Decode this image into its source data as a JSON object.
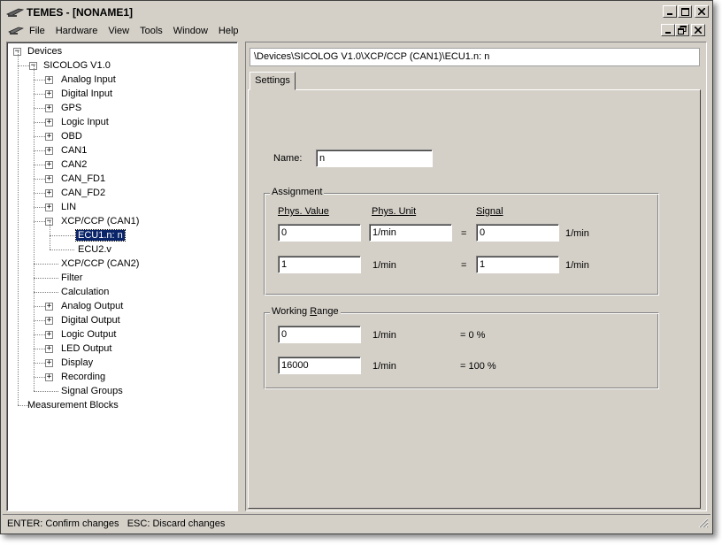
{
  "window": {
    "title": "TEMES - [NONAME1]"
  },
  "menu": {
    "items": [
      "File",
      "Hardware",
      "View",
      "Tools",
      "Window",
      "Help"
    ]
  },
  "tree": {
    "root": "Devices",
    "device": "SICOLOG V1.0",
    "items": [
      {
        "label": "Analog Input",
        "expandable": true
      },
      {
        "label": "Digital Input",
        "expandable": true
      },
      {
        "label": "GPS",
        "expandable": true
      },
      {
        "label": "Logic Input",
        "expandable": true
      },
      {
        "label": "OBD",
        "expandable": true
      },
      {
        "label": "CAN1",
        "expandable": true
      },
      {
        "label": "CAN2",
        "expandable": true
      },
      {
        "label": "CAN_FD1",
        "expandable": true
      },
      {
        "label": "CAN_FD2",
        "expandable": true
      },
      {
        "label": "LIN",
        "expandable": true
      },
      {
        "label": "XCP/CCP (CAN1)",
        "expandable": true,
        "expanded": true,
        "children": [
          {
            "label": "ECU1.n: n",
            "selected": true
          },
          {
            "label": "ECU2.v"
          }
        ]
      },
      {
        "label": "XCP/CCP (CAN2)",
        "expandable": false
      },
      {
        "label": "Filter",
        "expandable": false
      },
      {
        "label": "Calculation",
        "expandable": false
      },
      {
        "label": "Analog Output",
        "expandable": true
      },
      {
        "label": "Digital Output",
        "expandable": true
      },
      {
        "label": "Logic Output",
        "expandable": true
      },
      {
        "label": "LED Output",
        "expandable": true
      },
      {
        "label": "Display",
        "expandable": true
      },
      {
        "label": "Recording",
        "expandable": true
      },
      {
        "label": "Signal Groups",
        "expandable": false
      }
    ],
    "footer": "Measurement Blocks"
  },
  "path": "\\Devices\\SICOLOG V1.0\\XCP/CCP (CAN1)\\ECU1.n: n",
  "tabs": [
    "Settings"
  ],
  "settings": {
    "name_label": "Name:",
    "name_value": "n",
    "assignment": {
      "title": "Assignment",
      "col_phys_value": "Phys. Value",
      "col_phys_unit": "Phys. Unit",
      "col_signal": "Signal",
      "row1": {
        "phys_value": "0",
        "phys_unit": "1/min",
        "eq": "=",
        "signal": "0",
        "signal_unit": "1/min"
      },
      "row2": {
        "phys_value": "1",
        "phys_unit": "1/min",
        "eq": "=",
        "signal": "1",
        "signal_unit": "1/min"
      }
    },
    "working_range": {
      "title": "Working Range",
      "row1": {
        "value": "0",
        "unit": "1/min",
        "percent": "= 0 %"
      },
      "row2": {
        "value": "16000",
        "unit": "1/min",
        "percent": "= 100 %"
      }
    }
  },
  "status": {
    "text": "ENTER: Confirm changes   ESC: Discard changes"
  },
  "colors": {
    "face": "#d4d0c8",
    "selection": "#0a246a"
  }
}
